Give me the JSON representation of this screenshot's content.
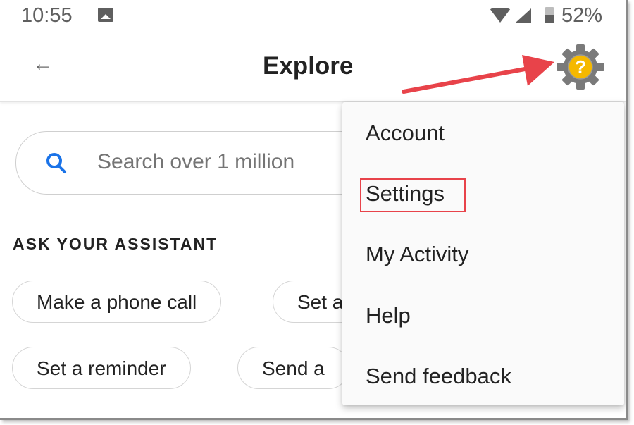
{
  "status_bar": {
    "time": "10:55",
    "notification_icon": "image-icon",
    "wifi_icon": "wifi-icon",
    "signal_icon": "cell-signal-icon",
    "battery_icon": "battery-icon",
    "battery_percent": "52%"
  },
  "app_bar": {
    "back_icon": "arrow-back-icon",
    "back_glyph": "←",
    "title": "Explore",
    "annotation_icon": "gear-help-icon",
    "annotation_glyph": "?"
  },
  "search": {
    "placeholder": "Search over 1 million"
  },
  "section": {
    "title": "ASK YOUR ASSISTANT",
    "chips": [
      {
        "label": "Make a phone call"
      },
      {
        "label": "Set a"
      },
      {
        "label": "Set a reminder"
      },
      {
        "label": "Send a"
      }
    ]
  },
  "menu": {
    "items": [
      {
        "label": "Account"
      },
      {
        "label": "Settings",
        "highlighted": true
      },
      {
        "label": "My Activity"
      },
      {
        "label": "Help"
      },
      {
        "label": "Send feedback"
      }
    ]
  },
  "colors": {
    "annotation_red": "#e8434a",
    "gear_gray": "#7a7a7a",
    "help_yellow": "#f5b800",
    "search_blue": "#1a73e8"
  }
}
